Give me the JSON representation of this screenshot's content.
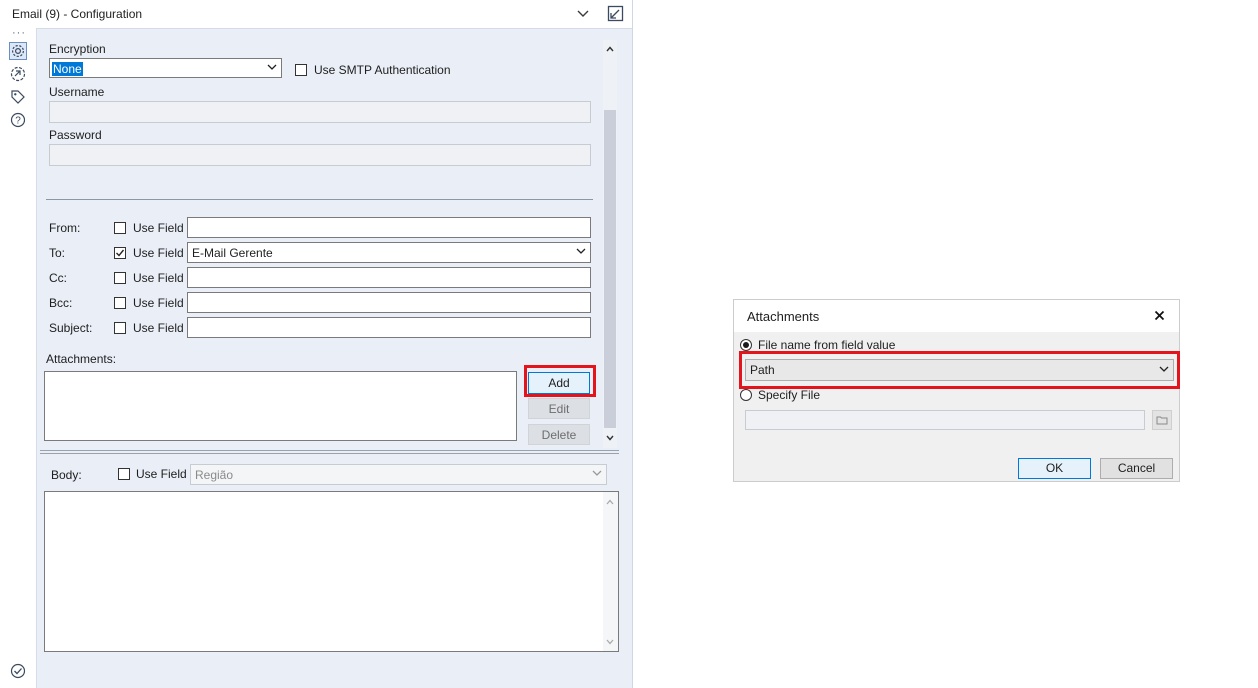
{
  "panel": {
    "title": "Email (9) - Configuration"
  },
  "smtp": {
    "encryption_label": "Encryption",
    "encryption_value": "None",
    "use_smtp_auth_label": "Use SMTP Authentication",
    "username_label": "Username",
    "password_label": "Password"
  },
  "fields": {
    "use_field_label": "Use Field",
    "from_label": "From:",
    "to_label": "To:",
    "to_value": "E-Mail Gerente",
    "to_use_field_checked": true,
    "cc_label": "Cc:",
    "bcc_label": "Bcc:",
    "subject_label": "Subject:"
  },
  "attachments": {
    "label": "Attachments:",
    "add_button": "Add",
    "edit_button": "Edit",
    "delete_button": "Delete"
  },
  "body": {
    "label": "Body:",
    "use_field_label": "Use Field",
    "field_value": "Região"
  },
  "dialog": {
    "title": "Attachments",
    "option_field_label": "File name from field value",
    "option_field_selected": true,
    "field_value": "Path",
    "option_file_label": "Specify File",
    "ok_button": "OK",
    "cancel_button": "Cancel"
  },
  "colors": {
    "highlight": "#e3141b",
    "panel_background": "#e9eef7",
    "selection": "#0078d7"
  },
  "icons": {
    "rail": [
      "gear-icon",
      "connection-icon",
      "tag-icon",
      "help-icon",
      "check-circle-icon"
    ],
    "header": [
      "chevron-down-icon",
      "popout-icon"
    ],
    "dialog": [
      "close-icon",
      "folder-icon"
    ]
  }
}
